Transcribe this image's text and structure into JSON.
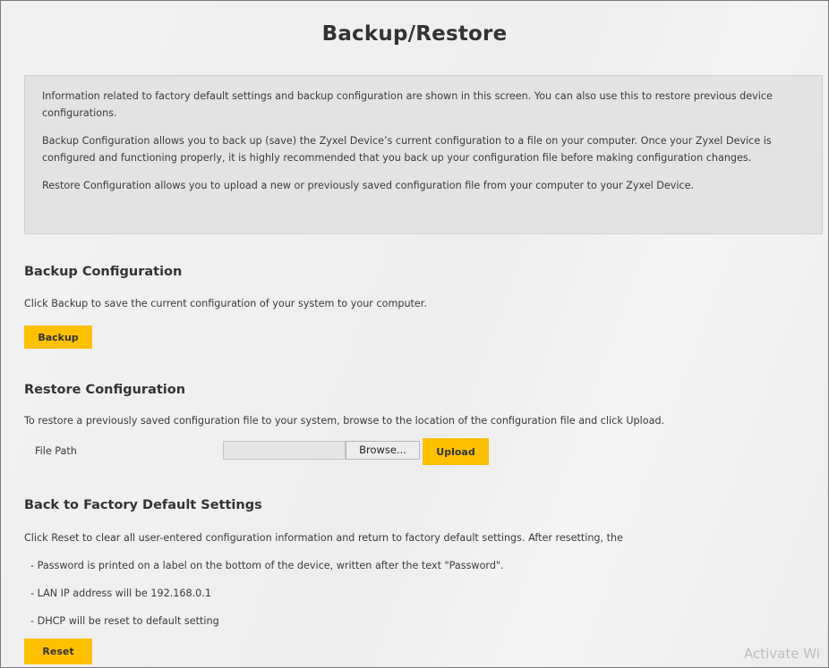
{
  "page": {
    "title": "Backup/Restore"
  },
  "info": {
    "paragraphs": [
      "Information related to factory default settings and backup configuration are shown in this screen. You can also use this to restore previous device configurations.",
      "Backup Configuration allows you to back up (save) the Zyxel Device’s current configuration to a file on your computer. Once your Zyxel Device is configured and functioning properly, it is highly recommended that you back up your configuration file before making configuration changes.",
      "Restore Configuration allows you to upload a new or previously saved configuration file from your computer to your Zyxel Device."
    ]
  },
  "backup": {
    "heading": "Backup Configuration",
    "description": "Click Backup to save the current configuration of your system to your computer.",
    "button_label": "Backup"
  },
  "restore": {
    "heading": "Restore Configuration",
    "description": "To restore a previously saved configuration file to your system, browse to the location of the configuration file and click Upload.",
    "file_path_label": "File Path",
    "file_path_value": "",
    "browse_label": "Browse...",
    "upload_label": "Upload"
  },
  "factory": {
    "heading": "Back to Factory Default Settings",
    "description": "Click Reset to clear all user-entered configuration information and return to factory default settings. After resetting, the",
    "items": [
      "- Password is printed on a label on the bottom of the device, written after the text \"Password\".",
      "- LAN IP address will be 192.168.0.1",
      "- DHCP will be reset to default setting"
    ],
    "reset_label": "Reset"
  },
  "watermark": {
    "text": "Activate Wi"
  },
  "colors": {
    "accent_button": "#ffc000",
    "info_box_bg": "#e3e3e3",
    "page_bg": "#eeeeee"
  }
}
